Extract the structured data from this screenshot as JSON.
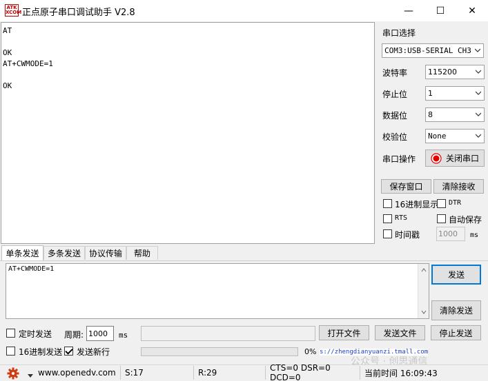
{
  "window": {
    "logo_line1": "ATK",
    "logo_line2": "XCOM",
    "title": "正点原子串口调试助手 V2.8",
    "minimize_glyph": "—",
    "maximize_glyph": "☐",
    "close_glyph": "✕"
  },
  "receive": {
    "lines": [
      "AT",
      "",
      "OK",
      "AT+CWMODE=1",
      "",
      "OK"
    ]
  },
  "settings": {
    "port_label": "串口选择",
    "port_value": "COM3:USB-SERIAL CH340",
    "baud_label": "波特率",
    "baud_value": "115200",
    "stop_label": "停止位",
    "stop_value": "1",
    "data_label": "数据位",
    "data_value": "8",
    "parity_label": "校验位",
    "parity_value": "None",
    "operation_label": "串口操作",
    "close_port_label": "关闭串口"
  },
  "actions": {
    "save_window": "保存窗口",
    "clear_receive": "清除接收"
  },
  "options": {
    "hex_display": "16进制显示",
    "dtr": "DTR",
    "rts": "RTS",
    "auto_save": "自动保存",
    "timestamp": "时间戳",
    "timestamp_value": "1000",
    "timestamp_unit": "ms"
  },
  "tabs": [
    "单条发送",
    "多条发送",
    "协议传输",
    "帮助"
  ],
  "send": {
    "text": "AT+CWMODE=1",
    "send_button": "发送",
    "clear_send_button": "清除发送"
  },
  "bottom": {
    "timed_send": "定时发送",
    "period_label": "周期:",
    "period_value": "1000",
    "period_unit": "ms",
    "open_file": "打开文件",
    "send_file": "发送文件",
    "stop_send": "停止发送",
    "hex_send": "16进制发送",
    "send_newline": "发送新行",
    "progress_text": "0%",
    "progress": 0,
    "url_text": "s://zhengdianyuanzi.tmall.com",
    "watermark": "公众号 · 创思通信"
  },
  "status": {
    "website": "www.openedv.com",
    "sent": "S:17",
    "received": "R:29",
    "lines": "CTS=0 DSR=0 DCD=0",
    "time": "当前时间 16:09:43"
  },
  "colors": {
    "close_port_icon": "#e00000",
    "gear_icon": "#d03a10",
    "send_button_border": "#0078d7"
  }
}
